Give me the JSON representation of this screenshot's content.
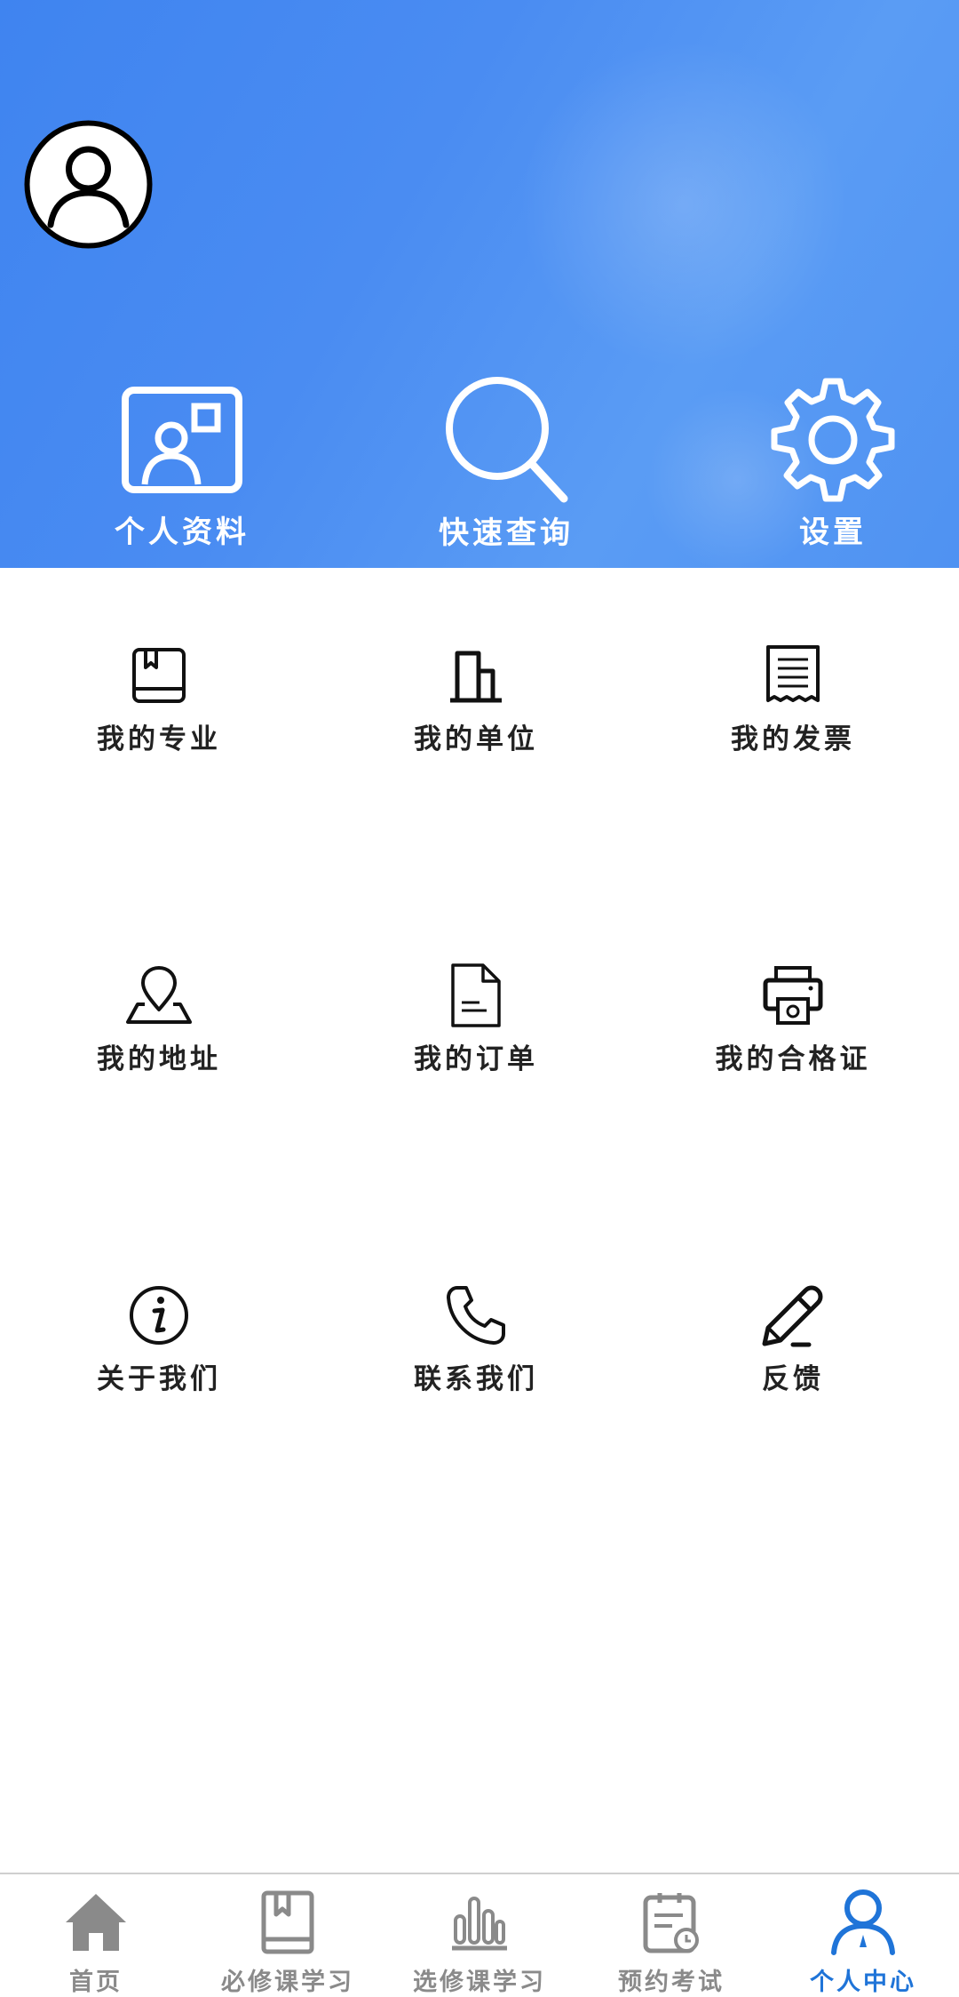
{
  "header": {
    "quick_actions": [
      {
        "label": "个人资料",
        "icon": "profile-card-icon"
      },
      {
        "label": "快速查询",
        "icon": "search-icon"
      },
      {
        "label": "设置",
        "icon": "gear-icon"
      }
    ]
  },
  "menu": {
    "items": [
      {
        "label": "我的专业",
        "icon": "book-icon"
      },
      {
        "label": "我的单位",
        "icon": "building-icon"
      },
      {
        "label": "我的发票",
        "icon": "receipt-icon"
      },
      {
        "label": "我的地址",
        "icon": "location-pin-icon"
      },
      {
        "label": "我的订单",
        "icon": "document-icon"
      },
      {
        "label": "我的合格证",
        "icon": "printer-icon"
      },
      {
        "label": "关于我们",
        "icon": "info-icon"
      },
      {
        "label": "联系我们",
        "icon": "phone-icon"
      },
      {
        "label": "反馈",
        "icon": "pencil-icon"
      }
    ]
  },
  "tabbar": {
    "tabs": [
      {
        "label": "首页",
        "icon": "home-icon",
        "active": false
      },
      {
        "label": "必修课学习",
        "icon": "book-icon",
        "active": false
      },
      {
        "label": "选修课学习",
        "icon": "bar-chart-icon",
        "active": false
      },
      {
        "label": "预约考试",
        "icon": "clipboard-clock-icon",
        "active": false
      },
      {
        "label": "个人中心",
        "icon": "user-icon",
        "active": true
      }
    ]
  },
  "colors": {
    "header_blue": "#4a8cf2",
    "active_tab": "#1f74d8",
    "inactive_tab": "#8a8a8a",
    "menu_text": "#222222"
  }
}
